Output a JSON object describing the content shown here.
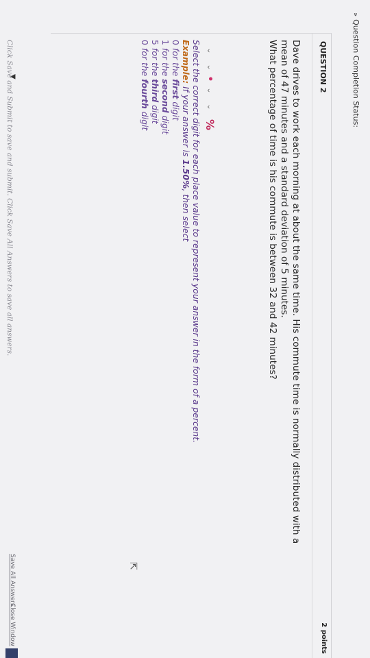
{
  "status": {
    "label": "Question Completion Status:",
    "chevron_icon": "double-chevron-down"
  },
  "question": {
    "header": "QUESTION 2",
    "points": "2 points",
    "text_line1": "Dave drives to work each morning at about the same time. His commute time is normally distributed with a",
    "text_line2": "mean of 47 minutes and a standard deviation of 5 minutes.",
    "text_line3": "What percentage of time is his commute is between 32 and 42 minutes?"
  },
  "answer": {
    "dropdown_glyph": "⌄",
    "decimal": "•",
    "percent": "%"
  },
  "instructions": {
    "line1": "Select the correct digit for each place value to represent your answer in the form of a percent.",
    "example_label": "Example:",
    "example_text": " If your answer is ",
    "example_value": "1.50%",
    "example_tail": ", then select",
    "items": [
      {
        "digit": "0",
        "pre": "for the ",
        "place": "first",
        "post": " digit"
      },
      {
        "digit": "1",
        "pre": "for the ",
        "place": "second",
        "post": " digit"
      },
      {
        "digit": "5",
        "pre": "for the ",
        "place": "third",
        "post": " digit"
      },
      {
        "digit": "0",
        "pre": "for the ",
        "place": "fourth",
        "post": " digit"
      }
    ]
  },
  "footer": {
    "text": "Click Save and Submit to save and submit. Click Save All Answers to save all answers.",
    "save_all": "Save All Answers",
    "close_window": "Close Window"
  }
}
